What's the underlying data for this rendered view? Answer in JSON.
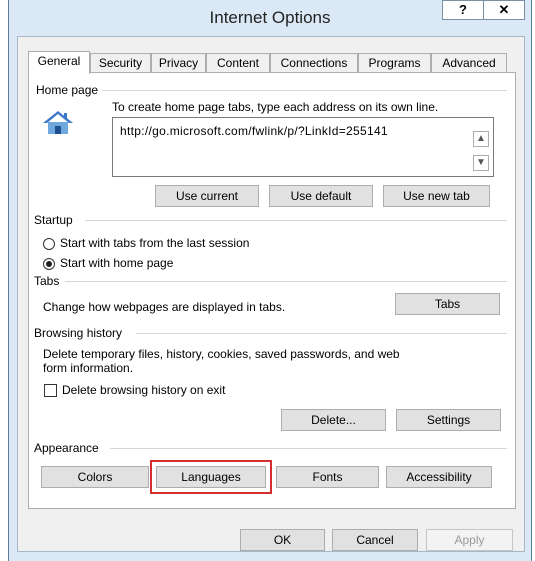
{
  "window": {
    "title": "Internet Options",
    "help_label": "?",
    "close_label": "✕"
  },
  "tabs": [
    {
      "label": "General",
      "active": true
    },
    {
      "label": "Security"
    },
    {
      "label": "Privacy"
    },
    {
      "label": "Content"
    },
    {
      "label": "Connections"
    },
    {
      "label": "Programs"
    },
    {
      "label": "Advanced"
    }
  ],
  "home_page": {
    "group_label": "Home page",
    "instruction": "To create home page tabs, type each address on its own line.",
    "url": "http://go.microsoft.com/fwlink/p/?LinkId=255141",
    "buttons": {
      "use_current": "Use current",
      "use_default": "Use default",
      "use_new_tab": "Use new tab"
    }
  },
  "startup": {
    "group_label": "Startup",
    "options": [
      {
        "label": "Start with tabs from the last session",
        "checked": false
      },
      {
        "label": "Start with home page",
        "checked": true
      }
    ]
  },
  "tabs_group": {
    "group_label": "Tabs",
    "description": "Change how webpages are displayed in tabs.",
    "button": "Tabs"
  },
  "browsing_history": {
    "group_label": "Browsing history",
    "description_line1": "Delete temporary files, history, cookies, saved passwords, and web",
    "description_line2": "form information.",
    "checkbox_label": "Delete browsing history on exit",
    "delete_button": "Delete...",
    "settings_button": "Settings"
  },
  "appearance": {
    "group_label": "Appearance",
    "colors_button": "Colors",
    "languages_button": "Languages",
    "fonts_button": "Fonts",
    "accessibility_button": "Accessibility",
    "highlight_color": "#d32f2f"
  },
  "footer": {
    "ok": "OK",
    "cancel": "Cancel",
    "apply": "Apply"
  },
  "icons": {
    "home": "house-icon",
    "scroll_up": "chevron-up-icon",
    "scroll_down": "chevron-down-icon"
  }
}
